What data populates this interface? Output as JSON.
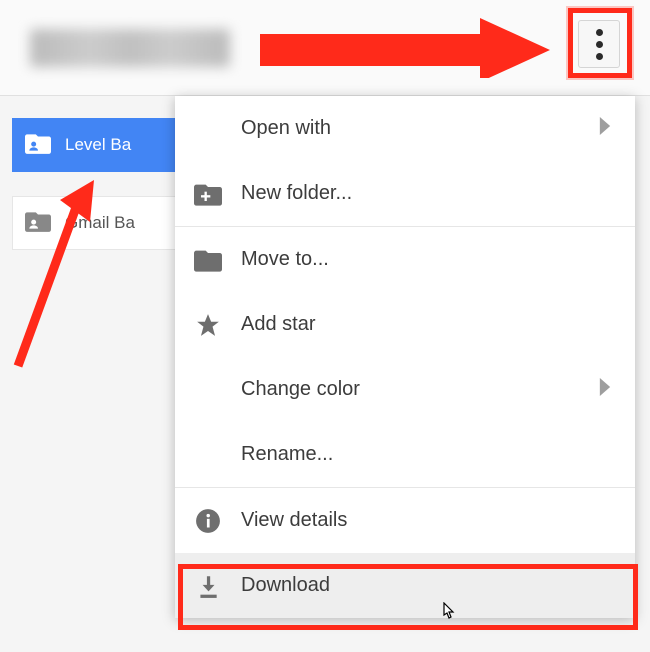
{
  "cards": {
    "selected": {
      "label": "Level Ba"
    },
    "second": {
      "label": "Gmail Ba"
    }
  },
  "menu": {
    "open_with": "Open with",
    "new_folder": "New folder...",
    "move_to": "Move to...",
    "add_star": "Add star",
    "change_color": "Change color",
    "rename": "Rename...",
    "view_details": "View details",
    "download": "Download"
  },
  "annotations": {
    "highlight_color": "#ff2a1a"
  }
}
